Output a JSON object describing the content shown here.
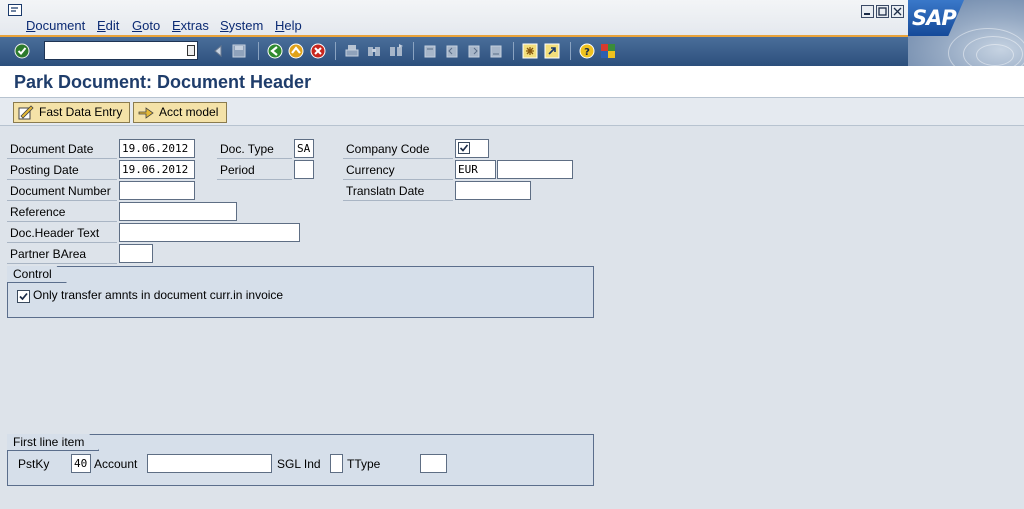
{
  "menu": {
    "items": [
      "Document",
      "Edit",
      "Goto",
      "Extras",
      "System",
      "Help"
    ]
  },
  "logo": "SAP",
  "window_buttons": [
    "minimize",
    "restore",
    "close"
  ],
  "toolbar": {
    "command_field_value": "",
    "icons": [
      "enter-icon",
      "back-icon",
      "save-icon",
      "back-nav-icon",
      "exit-icon",
      "cancel-icon",
      "print-icon",
      "find-icon",
      "find-next-icon",
      "first-page-icon",
      "previous-page-icon",
      "next-page-icon",
      "last-page-icon",
      "create-session-icon",
      "shortcut-icon",
      "help-icon",
      "customize-layout-icon"
    ]
  },
  "title": "Park Document: Document Header",
  "app_toolbar": {
    "fast_data_entry": "Fast Data Entry",
    "acct_model": "Acct model"
  },
  "header_fields": {
    "document_date_label": "Document Date",
    "document_date": "19.06.2012",
    "posting_date_label": "Posting Date",
    "posting_date": "19.06.2012",
    "document_number_label": "Document Number",
    "document_number": "",
    "reference_label": "Reference",
    "reference": "",
    "doc_header_text_label": "Doc.Header Text",
    "doc_header_text": "",
    "partner_barea_label": "Partner BArea",
    "partner_barea": "",
    "doc_type_label": "Doc. Type",
    "doc_type": "SA",
    "period_label": "Period",
    "period": "",
    "company_code_label": "Company Code",
    "company_code_checked": true,
    "currency_label": "Currency",
    "currency": "EUR",
    "currency_extra": "",
    "translatn_date_label": "Translatn Date",
    "translatn_date": ""
  },
  "control_group": {
    "title": "Control",
    "checkbox_label": "Only transfer amnts in document curr.in invoice",
    "checked": true
  },
  "first_line_item": {
    "title": "First line item",
    "pstky_label": "PstKy",
    "pstky": "40",
    "account_label": "Account",
    "account": "",
    "sgl_ind_label": "SGL Ind",
    "sgl_ind": "",
    "ttype_label": "TType",
    "ttype": ""
  }
}
